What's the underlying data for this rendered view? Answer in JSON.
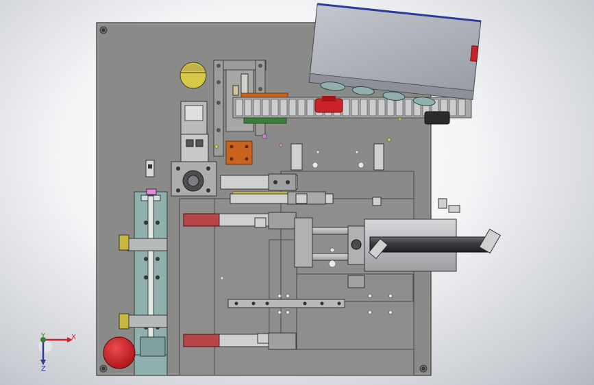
{
  "triad": {
    "x_label": "X",
    "y_label": "Y",
    "z_label": "Z"
  },
  "colors": {
    "background": "#eef0f3",
    "base_plate": "#8a8b88",
    "plate_edge": "#3a3b3a",
    "controller_box": "#a9adb5",
    "controller_top_edge": "#2d3a9a",
    "red_part": "#c8222a",
    "orange_part": "#c8641e",
    "green_part": "#3f7d3a",
    "cylinder_dark": "#3b3d40",
    "yellow_part": "#d7c846",
    "teal_part": "#8fb0ad",
    "bracket_dark": "#5f6160"
  }
}
